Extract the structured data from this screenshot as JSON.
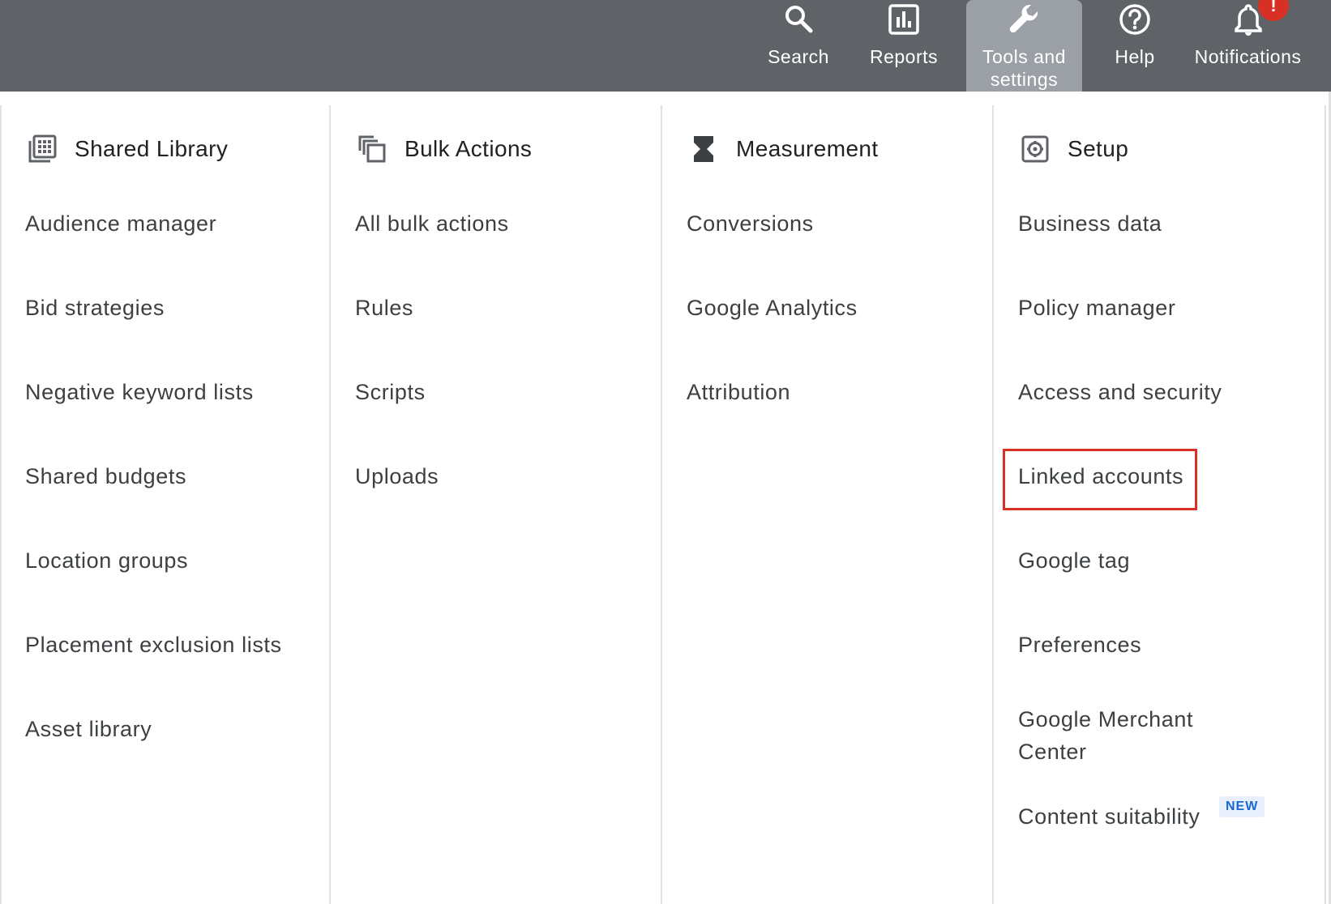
{
  "topbar": {
    "buttons": [
      {
        "label": "Search",
        "icon": "search-icon"
      },
      {
        "label": "Reports",
        "icon": "reports-icon"
      },
      {
        "label": "Tools and settings",
        "icon": "wrench-icon",
        "active": true
      },
      {
        "label": "Help",
        "icon": "help-icon"
      },
      {
        "label": "Notifications",
        "icon": "bell-icon",
        "badge": "!"
      }
    ]
  },
  "columns": [
    {
      "title": "Shared Library",
      "icon": "library-icon",
      "items": [
        "Audience manager",
        "Bid strategies",
        "Negative keyword lists",
        "Shared budgets",
        "Location groups",
        "Placement exclusion lists",
        "Asset library"
      ]
    },
    {
      "title": "Bulk Actions",
      "icon": "copy-icon",
      "items": [
        "All bulk actions",
        "Rules",
        "Scripts",
        "Uploads"
      ]
    },
    {
      "title": "Measurement",
      "icon": "hourglass-icon",
      "items": [
        "Conversions",
        "Google Analytics",
        "Attribution"
      ]
    },
    {
      "title": "Setup",
      "icon": "settings-icon",
      "items": [
        "Business data",
        "Policy manager",
        "Access and security",
        "Linked accounts",
        "Google tag",
        "Preferences",
        "Google Merchant Center",
        "Content suitability"
      ],
      "new_badge": "NEW"
    }
  ],
  "colors": {
    "topbar": "#5f6368",
    "active_tab": "#9aa0a6",
    "highlight": "#d93025",
    "badge": "#d93025",
    "new_badge_bg": "#e8f0fe",
    "new_badge_text": "#1967d2"
  }
}
